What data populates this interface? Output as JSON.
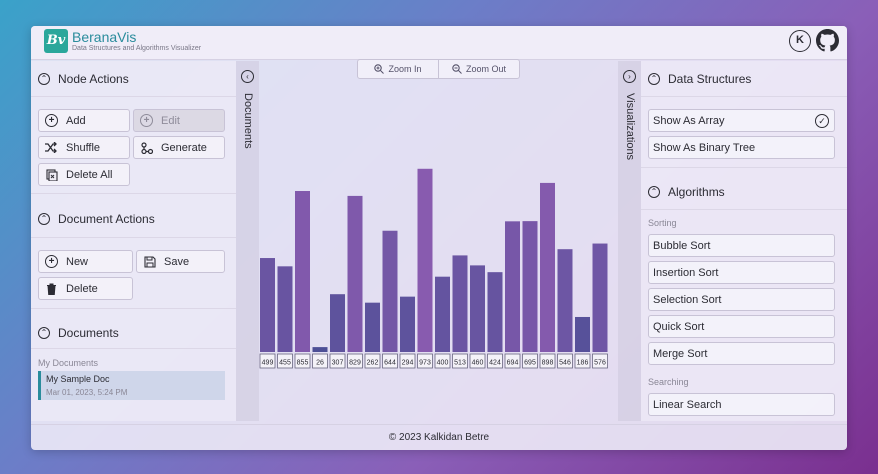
{
  "header": {
    "logo_text": "Bv",
    "brand_name": "BeranaVis",
    "brand_subtitle": "Data Structures and Algorithms Visualizer",
    "avatar_letter": "K",
    "github_icon": "github-icon"
  },
  "left": {
    "node_actions": {
      "title": "Node Actions",
      "add": "Add",
      "edit": "Edit",
      "shuffle": "Shuffle",
      "generate": "Generate",
      "delete_all": "Delete All"
    },
    "document_actions": {
      "title": "Document Actions",
      "new": "New",
      "save": "Save",
      "delete": "Delete"
    },
    "documents": {
      "title": "Documents",
      "group_label": "My Documents",
      "items": [
        {
          "title": "My Sample Doc",
          "date": "Mar 01, 2023, 5:24 PM"
        }
      ]
    }
  },
  "tabs": {
    "documents": "Documents",
    "visualizations": "Visualizations"
  },
  "zoom": {
    "zoom_in": "Zoom In",
    "zoom_out": "Zoom Out"
  },
  "right": {
    "data_structures": {
      "title": "Data Structures",
      "show_array": "Show As Array",
      "show_tree": "Show As Binary Tree"
    },
    "algorithms": {
      "title": "Algorithms",
      "sorting_label": "Sorting",
      "sorting": [
        "Bubble Sort",
        "Insertion Sort",
        "Selection Sort",
        "Quick Sort",
        "Merge Sort"
      ],
      "searching_label": "Searching",
      "searching": [
        "Linear Search"
      ]
    }
  },
  "footer": {
    "text": "© 2023 Kalkidan Betre"
  },
  "colors": {
    "bar_low": "#4b4f95",
    "bar_high": "#8a5bb0",
    "accent": "#2aa79b"
  },
  "chart_data": {
    "type": "bar",
    "values": [
      499,
      455,
      855,
      26,
      307,
      829,
      262,
      644,
      294,
      973,
      400,
      513,
      460,
      424,
      694,
      695,
      898,
      546,
      186,
      576
    ],
    "categories": [
      "499",
      "455",
      "855",
      "26",
      "307",
      "829",
      "262",
      "644",
      "294",
      "973",
      "400",
      "513",
      "460",
      "424",
      "694",
      "695",
      "898",
      "546",
      "186",
      "576"
    ],
    "ylim": [
      0,
      1000
    ]
  }
}
